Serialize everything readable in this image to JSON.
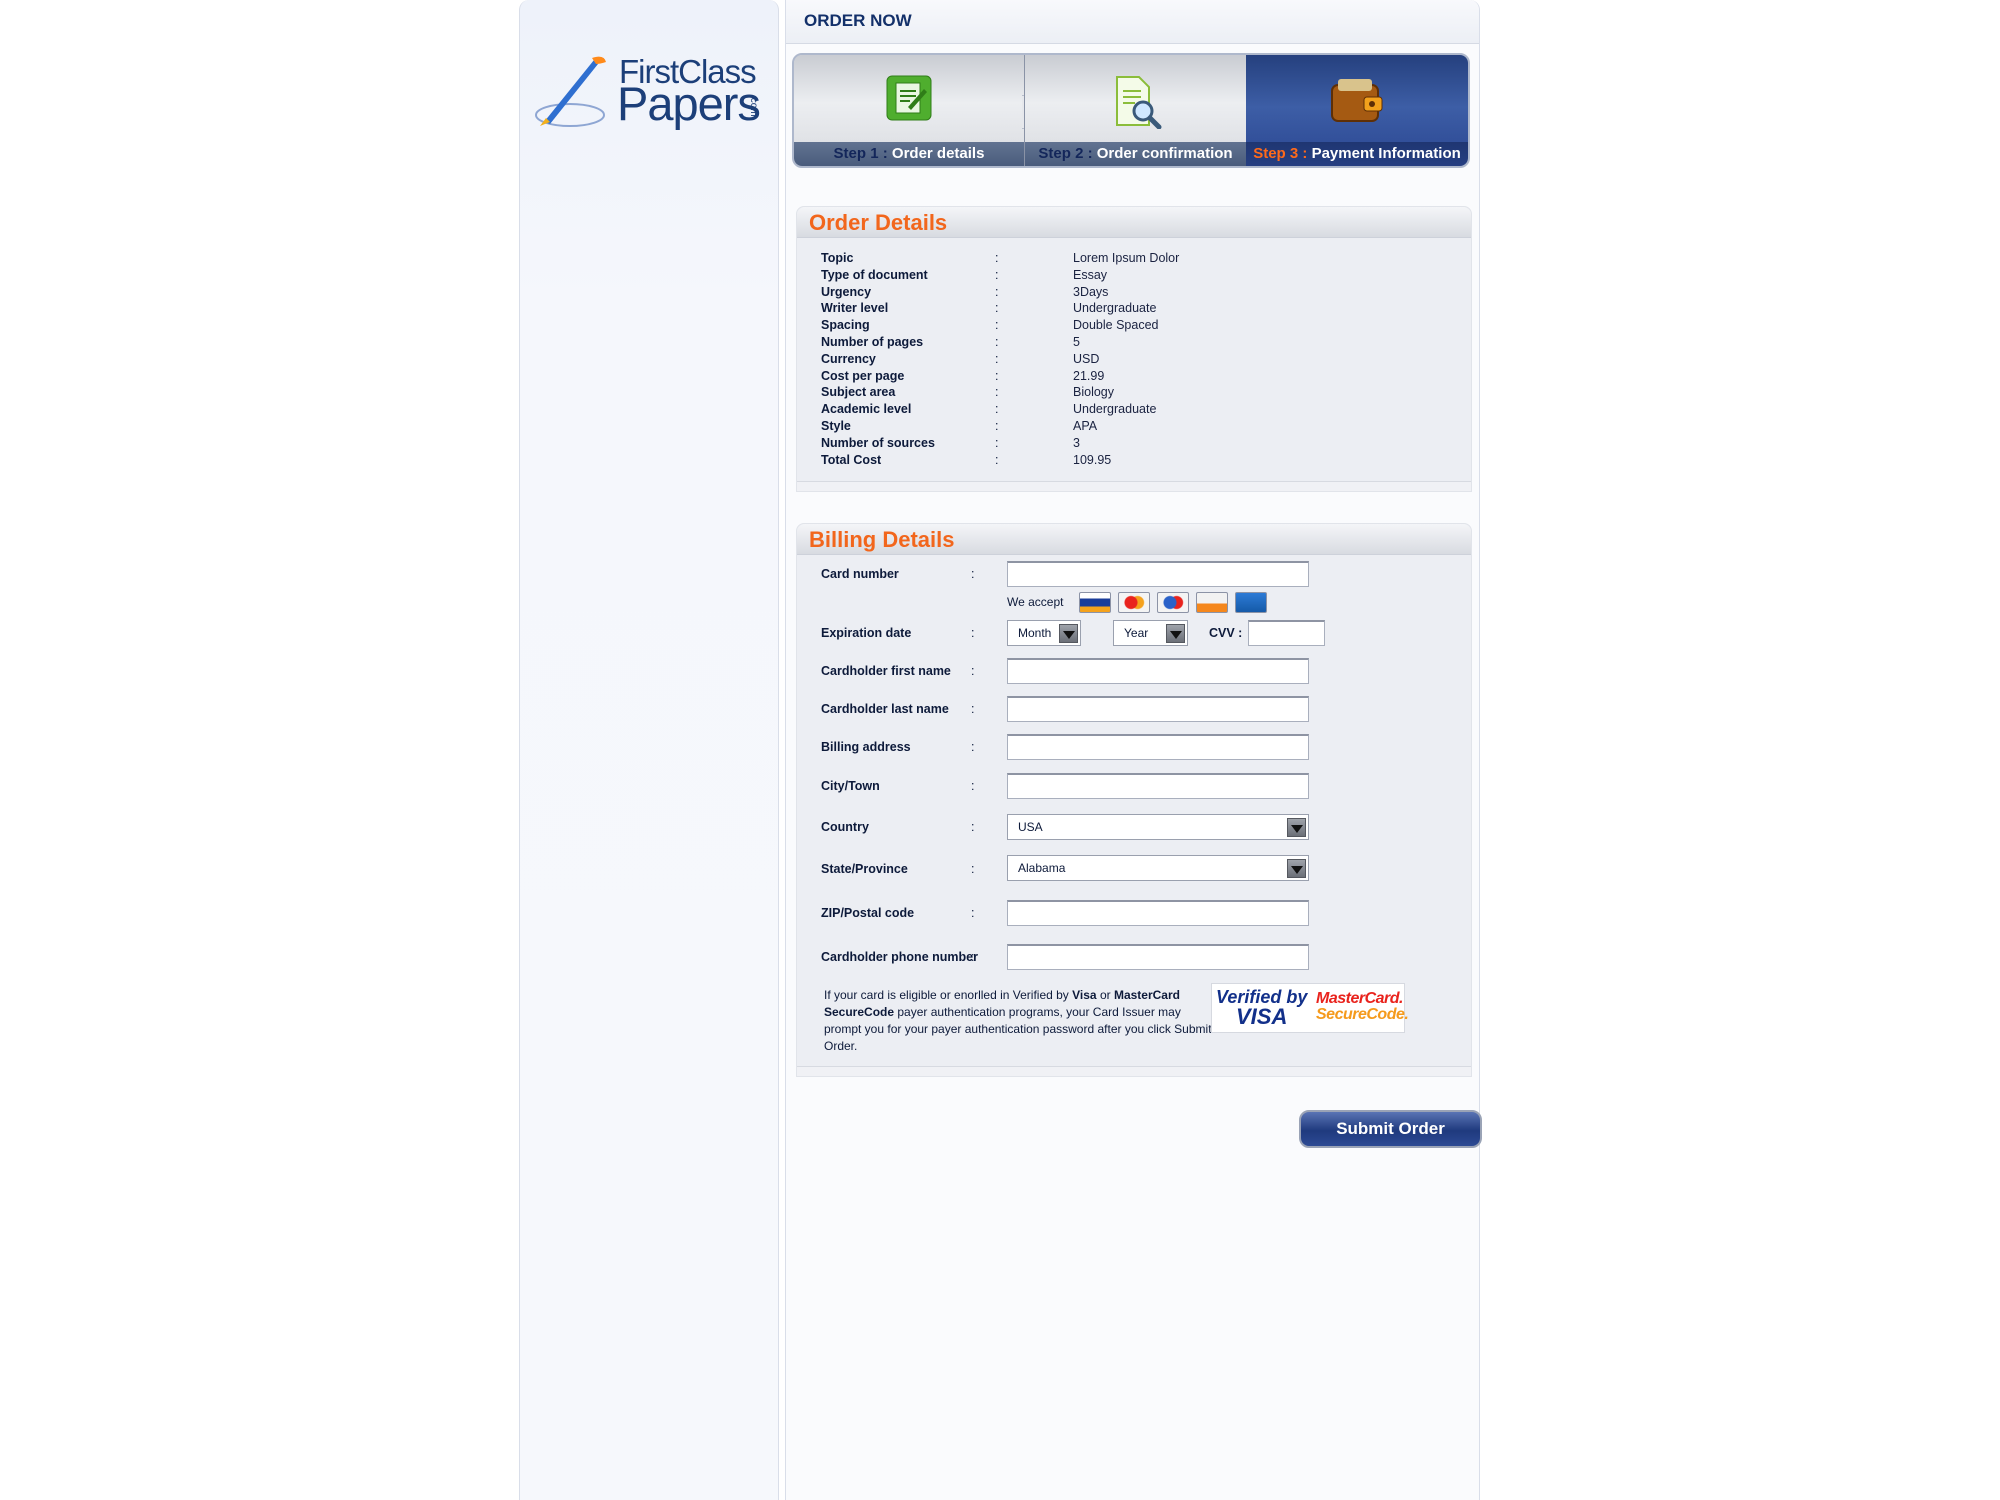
{
  "brand": {
    "line1": "FirstClass",
    "line2": "Papers",
    "suffix": ".com"
  },
  "header": {
    "title": "ORDER NOW"
  },
  "steps": [
    {
      "num": "Step 1 :",
      "label": "Order details",
      "active": false
    },
    {
      "num": "Step 2 :",
      "label": "Order confirmation",
      "active": false
    },
    {
      "num": "Step 3 :",
      "label": "Payment Information",
      "active": true
    }
  ],
  "order_details": {
    "title": "Order Details",
    "rows": [
      {
        "key": "Topic",
        "value": "Lorem Ipsum Dolor"
      },
      {
        "key": "Type of document",
        "value": "Essay"
      },
      {
        "key": "Urgency",
        "value": "3Days"
      },
      {
        "key": "Writer level",
        "value": "Undergraduate"
      },
      {
        "key": "Spacing",
        "value": "Double Spaced"
      },
      {
        "key": "Number of pages",
        "value": "5"
      },
      {
        "key": "Currency",
        "value": "USD"
      },
      {
        "key": "Cost per page",
        "value": "21.99"
      },
      {
        "key": "Subject area",
        "value": "Biology"
      },
      {
        "key": "Academic level",
        "value": "Undergraduate"
      },
      {
        "key": "Style",
        "value": "APA"
      },
      {
        "key": "Number of sources",
        "value": "3"
      },
      {
        "key": "Total Cost",
        "value": "109.95"
      }
    ]
  },
  "billing": {
    "title": "Billing Details",
    "separator": ":",
    "card_number": "Card number",
    "we_accept": "We accept",
    "accepted_cards": [
      "visa-icon",
      "mastercard-icon",
      "maestro-icon",
      "discover-icon",
      "amex-icon"
    ],
    "expiration_date": "Expiration date",
    "month": "Month",
    "year": "Year",
    "cvv": "CVV :",
    "first_name": "Cardholder first name",
    "last_name": "Cardholder last name",
    "address": "Billing address",
    "city": "City/Town",
    "country": "Country",
    "country_value": "USA",
    "state": "State/Province",
    "state_value": "Alabama",
    "zip": "ZIP/Postal code",
    "phone": "Cardholder phone number",
    "notice_a": "If your card is eligible or enorlled in Verified by ",
    "notice_visa": "Visa",
    "notice_or": " or ",
    "notice_mc": "MasterCard SecureCode",
    "notice_b": " payer authentication programs, your Card Issuer may prompt you for your payer authentication password after you click Submit Order.",
    "badge_vbv_1": "Verified by",
    "badge_vbv_2": "VISA",
    "badge_mc_1": "MasterCard.",
    "badge_mc_2": "SecureCode."
  },
  "submit_label": "Submit Order",
  "colors": {
    "accent_orange": "#f2661c",
    "navy": "#1c3f79",
    "step_active": "#2a478f"
  }
}
